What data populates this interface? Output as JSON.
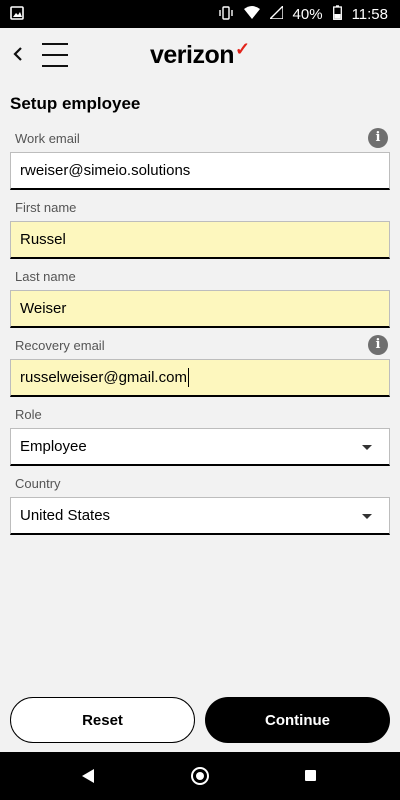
{
  "status_bar": {
    "battery": "40%",
    "time": "11:58"
  },
  "header": {
    "brand": "verizon",
    "brand_check": "✓"
  },
  "page": {
    "title": "Setup employee"
  },
  "form": {
    "work_email": {
      "label": "Work email",
      "value": "rweiser@simeio.solutions"
    },
    "first_name": {
      "label": "First name",
      "value": "Russel"
    },
    "last_name": {
      "label": "Last name",
      "value": "Weiser"
    },
    "recovery_email": {
      "label": "Recovery email",
      "value": "russelweiser@gmail.com"
    },
    "role": {
      "label": "Role",
      "value": "Employee"
    },
    "country": {
      "label": "Country",
      "value": "United States"
    },
    "info_icon": "i"
  },
  "actions": {
    "reset": "Reset",
    "continue": "Continue"
  },
  "colors": {
    "accent": "#e2231a",
    "filled_field": "#fdf7be",
    "button_dark": "#000000"
  }
}
